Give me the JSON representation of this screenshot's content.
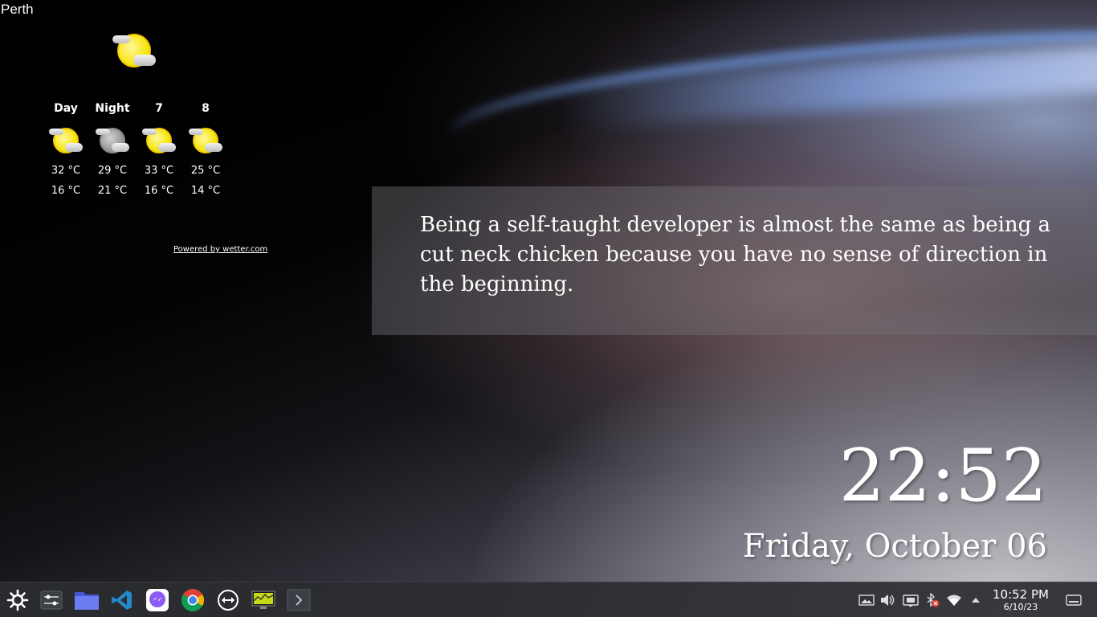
{
  "weather": {
    "city": "Perth",
    "current_icon": "partly-cloudy-sun-icon",
    "forecast": [
      {
        "label": "Day",
        "icon": "partly-cloudy-sun-icon",
        "high": "32 °C",
        "low": "16 °C"
      },
      {
        "label": "Night",
        "icon": "partly-cloudy-moon-icon",
        "high": "29 °C",
        "low": "21 °C"
      },
      {
        "label": "7",
        "icon": "partly-cloudy-sun-icon",
        "high": "33 °C",
        "low": "16 °C"
      },
      {
        "label": "8",
        "icon": "partly-cloudy-sun-icon",
        "high": "25 °C",
        "low": "14 °C"
      }
    ],
    "powered_by": "Powered by wetter.com"
  },
  "quote": {
    "text": "Being a self-taught developer is almost the same as being a cut neck chicken because you have no sense of direction in the beginning."
  },
  "clock": {
    "time": "22:52",
    "date": "Friday, October 06"
  },
  "taskbar": {
    "launcher_icon": "kde-launcher-icon",
    "apps": [
      {
        "name": "system-settings-icon"
      },
      {
        "name": "file-manager-icon"
      },
      {
        "name": "vscode-icon"
      },
      {
        "name": "messenger-icon"
      },
      {
        "name": "chrome-icon"
      },
      {
        "name": "teamviewer-icon"
      },
      {
        "name": "system-monitor-icon"
      },
      {
        "name": "terminal-icon"
      }
    ],
    "tray": {
      "icons": [
        "display-icon",
        "volume-icon",
        "battery-icon",
        "bluetooth-disabled-icon",
        "wifi-icon",
        "expand-tray-icon"
      ],
      "time": "10:52 PM",
      "date": "6/10/23",
      "show_desktop_icon": "show-desktop-icon"
    }
  },
  "colors": {
    "taskbar_bg": "#2a2c30",
    "sun_yellow": "#f7e81c",
    "vscode_blue": "#2489ca",
    "folder_blue": "#5b6ee8",
    "messenger_purple": "#8b5cf6"
  }
}
